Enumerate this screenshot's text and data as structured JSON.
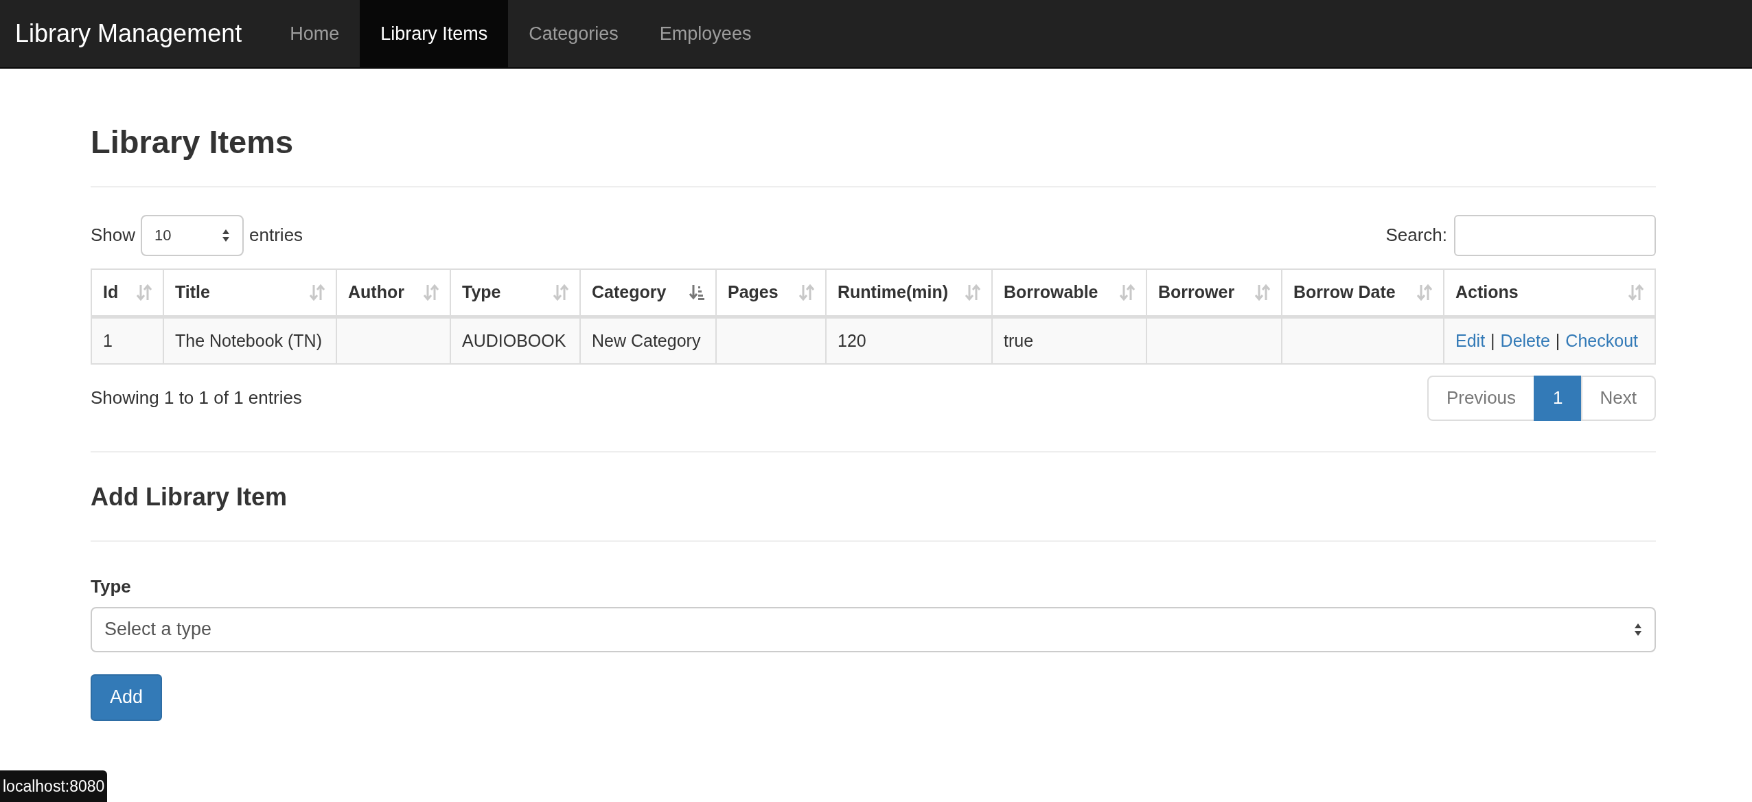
{
  "navbar": {
    "brand": "Library Management",
    "links": [
      {
        "label": "Home",
        "selected": false
      },
      {
        "label": "Library Items",
        "selected": true
      },
      {
        "label": "Categories",
        "selected": false
      },
      {
        "label": "Employees",
        "selected": false
      }
    ]
  },
  "page_title": "Library Items",
  "length_control": {
    "before": "Show",
    "value": "10",
    "after": "entries"
  },
  "search": {
    "label": "Search:"
  },
  "table": {
    "columns": [
      {
        "label": "Id",
        "sorted": false
      },
      {
        "label": "Title",
        "sorted": false
      },
      {
        "label": "Author",
        "sorted": false
      },
      {
        "label": "Type",
        "sorted": false
      },
      {
        "label": "Category",
        "sorted": true
      },
      {
        "label": "Pages",
        "sorted": false
      },
      {
        "label": "Runtime(min)",
        "sorted": false
      },
      {
        "label": "Borrowable",
        "sorted": false
      },
      {
        "label": "Borrower",
        "sorted": false
      },
      {
        "label": "Borrow Date",
        "sorted": false
      },
      {
        "label": "Actions",
        "sorted": false
      }
    ],
    "rows": [
      {
        "cells": [
          "1",
          "The Notebook (TN)",
          "",
          "AUDIOBOOK",
          "New Category",
          "",
          "120",
          "true",
          "",
          ""
        ],
        "actions": [
          "Edit",
          "Delete",
          "Checkout"
        ],
        "separator": "|"
      }
    ]
  },
  "info": "Showing 1 to 1 of 1 entries",
  "pagination": [
    {
      "label": "Previous",
      "selected": false
    },
    {
      "label": "1",
      "selected": true
    },
    {
      "label": "Next",
      "selected": false
    }
  ],
  "form": {
    "title": "Add Library Item",
    "field_label": "Type",
    "select_placeholder": "Select a type",
    "submit": "Add"
  },
  "status_url": "localhost:8080"
}
